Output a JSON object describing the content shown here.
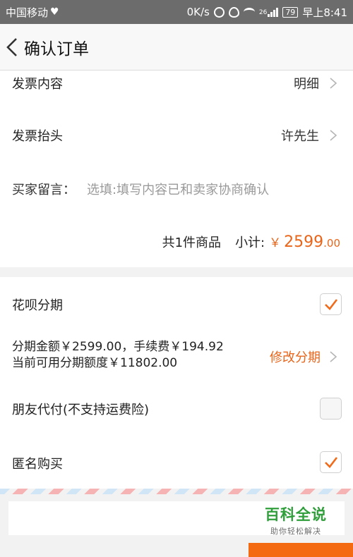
{
  "status_bar": {
    "carrier": "中国移动",
    "speed": "0K/s",
    "network": "26",
    "battery": "79",
    "time": "早上8:41"
  },
  "header": {
    "title": "确认订单"
  },
  "invoice": {
    "content_label": "发票内容",
    "content_value": "明细",
    "title_label": "发票抬头",
    "title_value": "许先生"
  },
  "buyer_note": {
    "label": "买家留言：",
    "placeholder": "选填:填写内容已和卖家协商确认"
  },
  "subtotal": {
    "count_text": "共1件商品",
    "label": "小计:",
    "currency": "￥",
    "price_int": "2599",
    "price_dec": ".00"
  },
  "huabei": {
    "label": "花呗分期",
    "checked": true,
    "installment_line1": "分期金额￥2599.00，手续费￥194.92",
    "installment_line2": "当前可用分期额度￥11802.00",
    "modify_label": "修改分期"
  },
  "friend_pay": {
    "label": "朋友代付(不支持运费险)",
    "checked": false
  },
  "anonymous": {
    "label": "匿名购买",
    "checked": true
  },
  "watermark": {
    "title": "百科全说",
    "subtitle": "助你轻松解决"
  },
  "colors": {
    "accent": "#e8651a",
    "check": "#f06a1a",
    "watermark": "#2f9e3b"
  }
}
